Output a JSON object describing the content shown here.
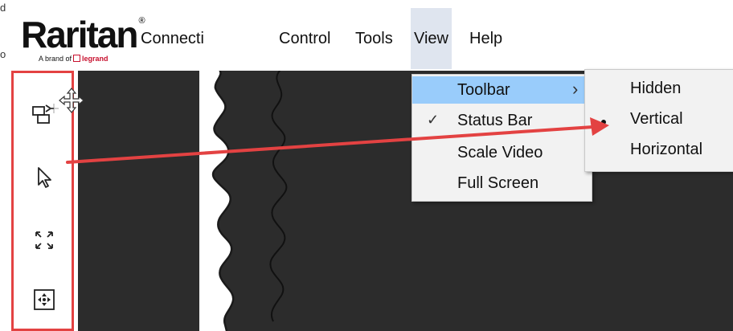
{
  "brand": {
    "name": "Raritan",
    "registered": "®",
    "tagline_prefix": "A brand of",
    "tagline_brand": "legrand"
  },
  "menubar": {
    "items": [
      {
        "label": "Connecti"
      },
      {
        "label": "Control"
      },
      {
        "label": "Tools"
      },
      {
        "label": "View"
      },
      {
        "label": "Help"
      }
    ]
  },
  "edge_glyphs": [
    "d",
    "o"
  ],
  "view_menu": {
    "items": [
      {
        "label": "Toolbar",
        "checked": false,
        "has_submenu": true,
        "highlighted": true
      },
      {
        "label": "Status Bar",
        "checked": true,
        "has_submenu": false
      },
      {
        "label": "Scale Video",
        "checked": false,
        "has_submenu": false
      },
      {
        "label": "Full Screen",
        "checked": false,
        "has_submenu": false
      }
    ],
    "check_glyph": "✓",
    "arrow_glyph": "›"
  },
  "toolbar_submenu": {
    "items": [
      {
        "label": "Hidden",
        "selected": false
      },
      {
        "label": "Vertical",
        "selected": true
      },
      {
        "label": "Horizontal",
        "selected": false
      }
    ]
  },
  "vertical_toolbar": {
    "tools": [
      {
        "icon": "switch-target-icon"
      },
      {
        "icon": "pointer-cursor-icon"
      },
      {
        "icon": "fit-screen-icon"
      },
      {
        "icon": "move-pan-icon"
      }
    ]
  },
  "colors": {
    "highlight": "#99ccfb",
    "callout": "#e34242",
    "screen": "#2c2c2c",
    "menu_bg": "#f2f2f2"
  }
}
